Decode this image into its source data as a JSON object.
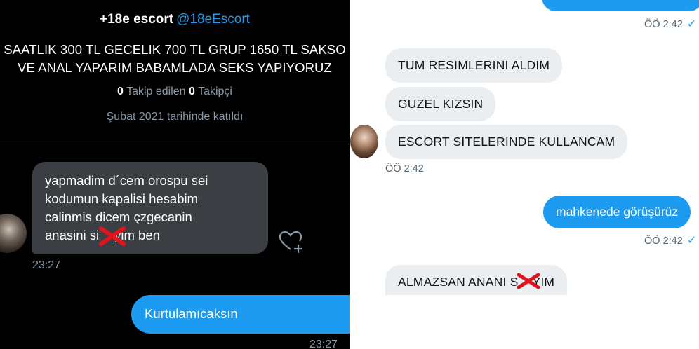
{
  "left": {
    "profile": {
      "name": "+18e escort",
      "handle": "@18eEscort",
      "bio_line1": "SAATLIK 300 TL GECELIK 700 TL GRUP 1650 TL SAKSO",
      "bio_line2": "VE ANAL YAPARIM BABAMLADA SEKS YAPIYORUZ",
      "following_count": "0",
      "following_label": "Takip edilen",
      "followers_count": "0",
      "followers_label": "Takipçi",
      "joined": "Şubat 2021 tarihinde katıldı"
    },
    "messages": [
      {
        "lines": [
          "yapmadim d´cem orospu sei",
          "kodumun kapalisi hesabim",
          "calinmis dicem çzgecanin",
          "anasini si",
          "yim ben"
        ],
        "time": "23:27",
        "direction": "incoming"
      },
      {
        "text": "Kurtulamıcaksın",
        "time": "23:27",
        "direction": "outgoing"
      }
    ],
    "icons": {
      "react": "heart-plus-icon",
      "censor": "red-x-icon"
    }
  },
  "right": {
    "top_time": "ÖÖ 2:42",
    "messages": [
      {
        "text": "TUM RESIMLERINI ALDIM",
        "direction": "incoming"
      },
      {
        "text": "GUZEL KIZSIN",
        "direction": "incoming"
      },
      {
        "text": "ESCORT SITELERINDE KULLANCAM",
        "direction": "incoming"
      },
      {
        "text": "mahkenede görüşürüz",
        "direction": "outgoing"
      },
      {
        "text_a": "ALMAZSAN ANANI S",
        "text_b": "YIM",
        "direction": "incoming"
      }
    ],
    "time_incoming": "ÖÖ 2:42",
    "time_outgoing": "ÖÖ 2:42",
    "tick": "✓",
    "colors": {
      "accent": "#1d9bf0",
      "bubble_light": "#ebeef0",
      "bubble_dark": "#3b3f44"
    }
  }
}
